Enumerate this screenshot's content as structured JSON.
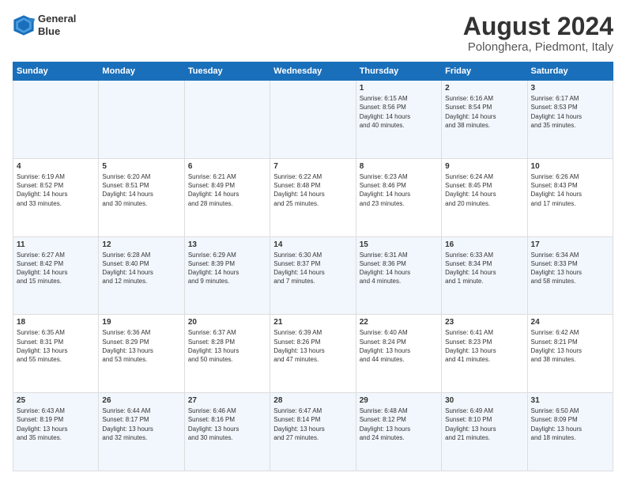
{
  "logo": {
    "line1": "General",
    "line2": "Blue"
  },
  "title": "August 2024",
  "subtitle": "Polonghera, Piedmont, Italy",
  "days_of_week": [
    "Sunday",
    "Monday",
    "Tuesday",
    "Wednesday",
    "Thursday",
    "Friday",
    "Saturday"
  ],
  "weeks": [
    [
      {
        "day": "",
        "info": ""
      },
      {
        "day": "",
        "info": ""
      },
      {
        "day": "",
        "info": ""
      },
      {
        "day": "",
        "info": ""
      },
      {
        "day": "1",
        "info": "Sunrise: 6:15 AM\nSunset: 8:56 PM\nDaylight: 14 hours\nand 40 minutes."
      },
      {
        "day": "2",
        "info": "Sunrise: 6:16 AM\nSunset: 8:54 PM\nDaylight: 14 hours\nand 38 minutes."
      },
      {
        "day": "3",
        "info": "Sunrise: 6:17 AM\nSunset: 8:53 PM\nDaylight: 14 hours\nand 35 minutes."
      }
    ],
    [
      {
        "day": "4",
        "info": "Sunrise: 6:19 AM\nSunset: 8:52 PM\nDaylight: 14 hours\nand 33 minutes."
      },
      {
        "day": "5",
        "info": "Sunrise: 6:20 AM\nSunset: 8:51 PM\nDaylight: 14 hours\nand 30 minutes."
      },
      {
        "day": "6",
        "info": "Sunrise: 6:21 AM\nSunset: 8:49 PM\nDaylight: 14 hours\nand 28 minutes."
      },
      {
        "day": "7",
        "info": "Sunrise: 6:22 AM\nSunset: 8:48 PM\nDaylight: 14 hours\nand 25 minutes."
      },
      {
        "day": "8",
        "info": "Sunrise: 6:23 AM\nSunset: 8:46 PM\nDaylight: 14 hours\nand 23 minutes."
      },
      {
        "day": "9",
        "info": "Sunrise: 6:24 AM\nSunset: 8:45 PM\nDaylight: 14 hours\nand 20 minutes."
      },
      {
        "day": "10",
        "info": "Sunrise: 6:26 AM\nSunset: 8:43 PM\nDaylight: 14 hours\nand 17 minutes."
      }
    ],
    [
      {
        "day": "11",
        "info": "Sunrise: 6:27 AM\nSunset: 8:42 PM\nDaylight: 14 hours\nand 15 minutes."
      },
      {
        "day": "12",
        "info": "Sunrise: 6:28 AM\nSunset: 8:40 PM\nDaylight: 14 hours\nand 12 minutes."
      },
      {
        "day": "13",
        "info": "Sunrise: 6:29 AM\nSunset: 8:39 PM\nDaylight: 14 hours\nand 9 minutes."
      },
      {
        "day": "14",
        "info": "Sunrise: 6:30 AM\nSunset: 8:37 PM\nDaylight: 14 hours\nand 7 minutes."
      },
      {
        "day": "15",
        "info": "Sunrise: 6:31 AM\nSunset: 8:36 PM\nDaylight: 14 hours\nand 4 minutes."
      },
      {
        "day": "16",
        "info": "Sunrise: 6:33 AM\nSunset: 8:34 PM\nDaylight: 14 hours\nand 1 minute."
      },
      {
        "day": "17",
        "info": "Sunrise: 6:34 AM\nSunset: 8:33 PM\nDaylight: 13 hours\nand 58 minutes."
      }
    ],
    [
      {
        "day": "18",
        "info": "Sunrise: 6:35 AM\nSunset: 8:31 PM\nDaylight: 13 hours\nand 55 minutes."
      },
      {
        "day": "19",
        "info": "Sunrise: 6:36 AM\nSunset: 8:29 PM\nDaylight: 13 hours\nand 53 minutes."
      },
      {
        "day": "20",
        "info": "Sunrise: 6:37 AM\nSunset: 8:28 PM\nDaylight: 13 hours\nand 50 minutes."
      },
      {
        "day": "21",
        "info": "Sunrise: 6:39 AM\nSunset: 8:26 PM\nDaylight: 13 hours\nand 47 minutes."
      },
      {
        "day": "22",
        "info": "Sunrise: 6:40 AM\nSunset: 8:24 PM\nDaylight: 13 hours\nand 44 minutes."
      },
      {
        "day": "23",
        "info": "Sunrise: 6:41 AM\nSunset: 8:23 PM\nDaylight: 13 hours\nand 41 minutes."
      },
      {
        "day": "24",
        "info": "Sunrise: 6:42 AM\nSunset: 8:21 PM\nDaylight: 13 hours\nand 38 minutes."
      }
    ],
    [
      {
        "day": "25",
        "info": "Sunrise: 6:43 AM\nSunset: 8:19 PM\nDaylight: 13 hours\nand 35 minutes."
      },
      {
        "day": "26",
        "info": "Sunrise: 6:44 AM\nSunset: 8:17 PM\nDaylight: 13 hours\nand 32 minutes."
      },
      {
        "day": "27",
        "info": "Sunrise: 6:46 AM\nSunset: 8:16 PM\nDaylight: 13 hours\nand 30 minutes."
      },
      {
        "day": "28",
        "info": "Sunrise: 6:47 AM\nSunset: 8:14 PM\nDaylight: 13 hours\nand 27 minutes."
      },
      {
        "day": "29",
        "info": "Sunrise: 6:48 AM\nSunset: 8:12 PM\nDaylight: 13 hours\nand 24 minutes."
      },
      {
        "day": "30",
        "info": "Sunrise: 6:49 AM\nSunset: 8:10 PM\nDaylight: 13 hours\nand 21 minutes."
      },
      {
        "day": "31",
        "info": "Sunrise: 6:50 AM\nSunset: 8:09 PM\nDaylight: 13 hours\nand 18 minutes."
      }
    ]
  ]
}
